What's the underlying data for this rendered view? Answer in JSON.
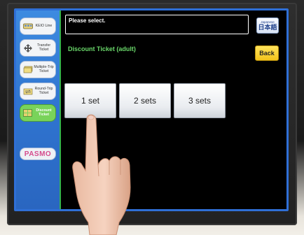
{
  "sidebar": {
    "items": [
      {
        "label": "KEIO Line",
        "icon": "train-icon",
        "active": false
      },
      {
        "label": "Transfer Ticket",
        "icon": "transfer-icon",
        "active": false
      },
      {
        "label": "Multiple-Trip Ticket",
        "icon": "ticket-stack-icon",
        "active": false
      },
      {
        "label": "Round-Trip Ticket",
        "icon": "round-trip-icon",
        "active": false
      },
      {
        "label": "Discount Ticket",
        "icon": "discount-ticket-icon",
        "active": true
      }
    ],
    "pasmo_logo": "PASMO"
  },
  "header": {
    "prompt": "Please select.",
    "language_button": {
      "small": "Japanese",
      "big": "日本語"
    }
  },
  "main": {
    "subtitle": "Discount Ticket (adult)",
    "back_label": "Back",
    "options": [
      {
        "label": "1 set"
      },
      {
        "label": "2 sets"
      },
      {
        "label": "3 sets"
      }
    ]
  },
  "colors": {
    "sidebar_blue": "#2f74d0",
    "frame_green": "#34b34c",
    "active_green": "#79d35a",
    "back_yellow": "#f2c21a",
    "subtitle_green": "#6ad86a",
    "pasmo_pink": "#d64b8c"
  }
}
